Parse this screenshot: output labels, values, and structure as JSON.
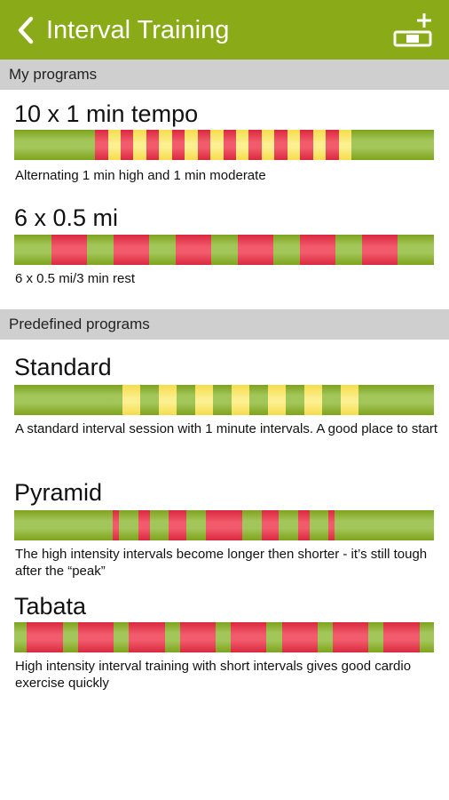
{
  "appbar": {
    "title": "Interval Training"
  },
  "colors": {
    "accent": "#8aab17",
    "rest": "#a3c65a",
    "high": "#ef4f60",
    "moderate": "#f9e878",
    "section_bg": "#cfcfcf"
  },
  "sections": {
    "my_programs": "My programs",
    "predefined_programs": "Predefined programs"
  },
  "programs": [
    {
      "id": "tempo",
      "name": "10 x 1 min tempo",
      "description": "Alternating 1 min high and 1 min moderate",
      "segments": [
        {
          "type": "high",
          "start": 0.192,
          "end": 0.224
        },
        {
          "type": "moderate",
          "start": 0.224,
          "end": 0.253
        },
        {
          "type": "high",
          "start": 0.253,
          "end": 0.283
        },
        {
          "type": "moderate",
          "start": 0.283,
          "end": 0.314
        },
        {
          "type": "high",
          "start": 0.314,
          "end": 0.345
        },
        {
          "type": "moderate",
          "start": 0.345,
          "end": 0.376
        },
        {
          "type": "high",
          "start": 0.376,
          "end": 0.406
        },
        {
          "type": "moderate",
          "start": 0.406,
          "end": 0.437
        },
        {
          "type": "high",
          "start": 0.437,
          "end": 0.467
        },
        {
          "type": "moderate",
          "start": 0.467,
          "end": 0.498
        },
        {
          "type": "high",
          "start": 0.498,
          "end": 0.528
        },
        {
          "type": "moderate",
          "start": 0.528,
          "end": 0.559
        },
        {
          "type": "high",
          "start": 0.559,
          "end": 0.59
        },
        {
          "type": "moderate",
          "start": 0.59,
          "end": 0.62
        },
        {
          "type": "high",
          "start": 0.62,
          "end": 0.651
        },
        {
          "type": "moderate",
          "start": 0.651,
          "end": 0.681
        },
        {
          "type": "high",
          "start": 0.681,
          "end": 0.712
        },
        {
          "type": "moderate",
          "start": 0.712,
          "end": 0.742
        },
        {
          "type": "high",
          "start": 0.742,
          "end": 0.773
        },
        {
          "type": "moderate",
          "start": 0.773,
          "end": 0.803
        }
      ]
    },
    {
      "id": "half-mile",
      "name": "6 x 0.5 mi",
      "description": "6 x 0.5 mi/3 min rest",
      "segments": [
        {
          "type": "high",
          "start": 0.089,
          "end": 0.173
        },
        {
          "type": "high",
          "start": 0.236,
          "end": 0.321
        },
        {
          "type": "high",
          "start": 0.384,
          "end": 0.469
        },
        {
          "type": "high",
          "start": 0.533,
          "end": 0.618
        },
        {
          "type": "high",
          "start": 0.681,
          "end": 0.766
        },
        {
          "type": "high",
          "start": 0.829,
          "end": 0.914
        }
      ]
    },
    {
      "id": "standard",
      "name": "Standard",
      "description": "A standard interval session with 1 minute intervals. A good place to start",
      "segments": [
        {
          "type": "moderate",
          "start": 0.258,
          "end": 0.3
        },
        {
          "type": "moderate",
          "start": 0.345,
          "end": 0.386
        },
        {
          "type": "moderate",
          "start": 0.431,
          "end": 0.473
        },
        {
          "type": "moderate",
          "start": 0.518,
          "end": 0.56
        },
        {
          "type": "moderate",
          "start": 0.605,
          "end": 0.647
        },
        {
          "type": "moderate",
          "start": 0.692,
          "end": 0.734
        },
        {
          "type": "moderate",
          "start": 0.779,
          "end": 0.821
        }
      ]
    },
    {
      "id": "pyramid",
      "name": "Pyramid",
      "description": "The high intensity intervals become longer then shorter - it’s still tough after the “peak”",
      "segments": [
        {
          "type": "high",
          "start": 0.235,
          "end": 0.25
        },
        {
          "type": "high",
          "start": 0.296,
          "end": 0.323
        },
        {
          "type": "high",
          "start": 0.368,
          "end": 0.41
        },
        {
          "type": "high",
          "start": 0.456,
          "end": 0.543
        },
        {
          "type": "high",
          "start": 0.589,
          "end": 0.631
        },
        {
          "type": "high",
          "start": 0.676,
          "end": 0.704
        },
        {
          "type": "high",
          "start": 0.748,
          "end": 0.763
        }
      ]
    },
    {
      "id": "tabata",
      "name": "Tabata",
      "description": "High intensity interval training with short intervals gives good cardio exercise quickly",
      "segments": [
        {
          "type": "high",
          "start": 0.03,
          "end": 0.116
        },
        {
          "type": "high",
          "start": 0.152,
          "end": 0.237
        },
        {
          "type": "high",
          "start": 0.273,
          "end": 0.359
        },
        {
          "type": "high",
          "start": 0.395,
          "end": 0.48
        },
        {
          "type": "high",
          "start": 0.516,
          "end": 0.601
        },
        {
          "type": "high",
          "start": 0.638,
          "end": 0.723
        },
        {
          "type": "high",
          "start": 0.759,
          "end": 0.844
        },
        {
          "type": "high",
          "start": 0.88,
          "end": 0.966
        }
      ]
    }
  ]
}
